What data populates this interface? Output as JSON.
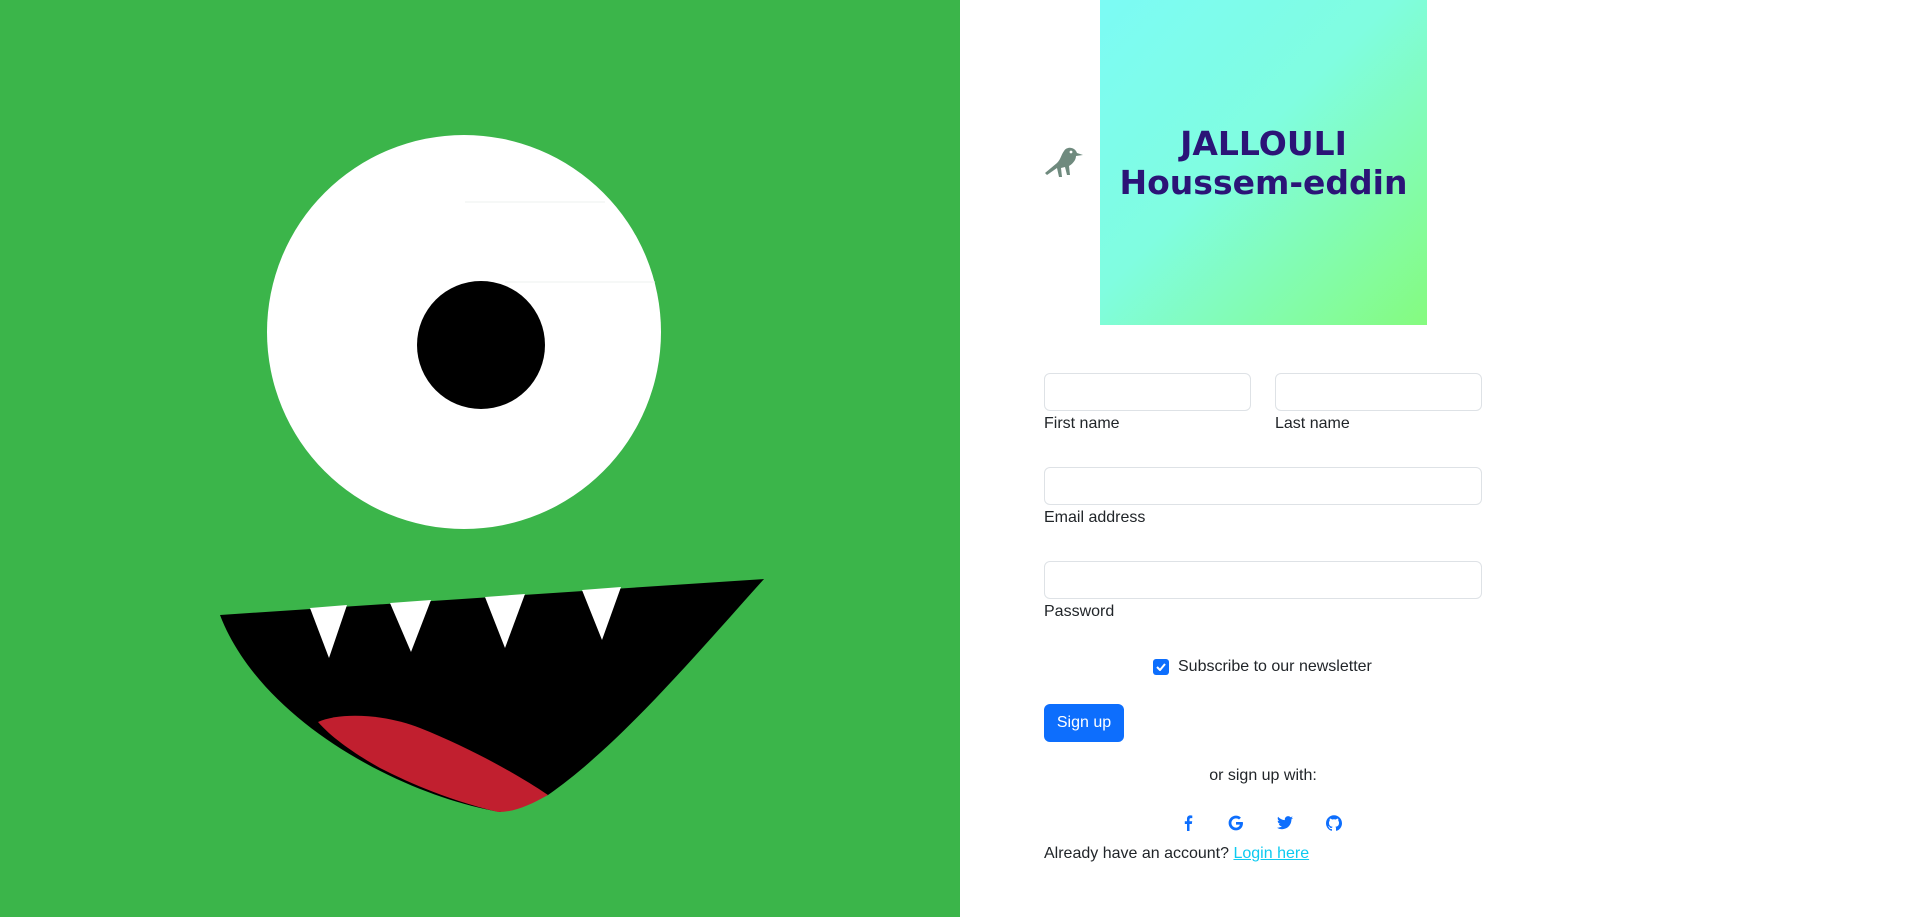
{
  "brand": {
    "line1": "JALLOULI",
    "line2": "Houssem-eddin"
  },
  "icons": {
    "logo": "crow-icon",
    "facebook": "facebook-icon",
    "google": "google-icon",
    "twitter": "twitter-icon",
    "github": "github-icon"
  },
  "form": {
    "first_name": {
      "label": "First name",
      "value": "",
      "placeholder": ""
    },
    "last_name": {
      "label": "Last name",
      "value": "",
      "placeholder": ""
    },
    "email": {
      "label": "Email address",
      "value": "",
      "placeholder": ""
    },
    "password": {
      "label": "Password",
      "value": "",
      "placeholder": ""
    },
    "newsletter": {
      "label": "Subscribe to our newsletter",
      "checked": true
    },
    "submit_label": "Sign up"
  },
  "social": {
    "prompt": "or sign up with:"
  },
  "login": {
    "prompt": "Already have an account?",
    "link_label": "Login here"
  },
  "colors": {
    "accent": "#0d6efd",
    "link": "#0dcaf0",
    "monster_green": "#3bb54a",
    "brand_text": "#2b1477"
  }
}
